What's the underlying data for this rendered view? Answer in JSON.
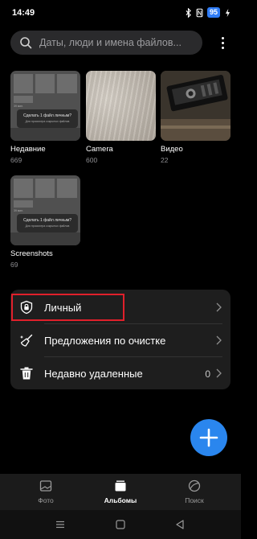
{
  "status_bar": {
    "time": "14:49",
    "battery": "95",
    "icons": [
      "bluetooth-icon",
      "nfc-icon",
      "charging-icon"
    ]
  },
  "search": {
    "placeholder": "Даты, люди и имена файлов..."
  },
  "albums": [
    {
      "name": "Недавние",
      "count": "669",
      "thumbnail": "screenshot-preview"
    },
    {
      "name": "Camera",
      "count": "600",
      "thumbnail": "photo-preview"
    },
    {
      "name": "Видео",
      "count": "22",
      "thumbnail": "video-preview"
    },
    {
      "name": "Screenshots",
      "count": "69",
      "thumbnail": "screenshot-preview"
    }
  ],
  "thumbnail_text": {
    "popup_title": "Сделать 1 файл личным?",
    "popup_sub": "Для просмотра сокрытых файлов",
    "mini_label": "39 мин."
  },
  "menu": {
    "items": [
      {
        "label": "Личный",
        "icon": "lock-icon",
        "count": ""
      },
      {
        "label": "Предложения по очистке",
        "icon": "broom-icon",
        "count": ""
      },
      {
        "label": "Недавно удаленные",
        "icon": "trash-icon",
        "count": "0"
      }
    ]
  },
  "fab": {
    "icon": "plus-icon"
  },
  "bottom_nav": {
    "items": [
      {
        "label": "Фото",
        "icon": "photos-icon",
        "active": false
      },
      {
        "label": "Альбомы",
        "icon": "albums-icon",
        "active": true
      },
      {
        "label": "Поиск",
        "icon": "explore-icon",
        "active": false
      }
    ]
  },
  "colors": {
    "accent": "#2a86ee",
    "highlight": "#e0202b",
    "battery": "#2f7cf6",
    "card": "#1e1e1e",
    "background": "#000000"
  }
}
